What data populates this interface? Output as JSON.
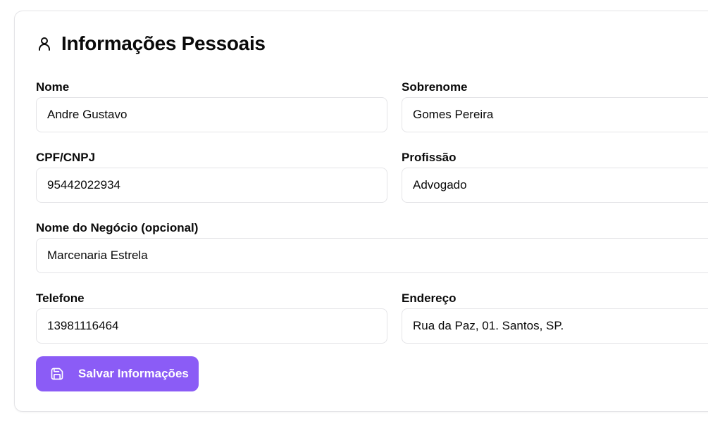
{
  "section": {
    "title": "Informações Pessoais",
    "icon": "user-icon"
  },
  "fields": {
    "nome": {
      "label": "Nome",
      "value": "Andre Gustavo"
    },
    "sobrenome": {
      "label": "Sobrenome",
      "value": "Gomes Pereira"
    },
    "cpf_cnpj": {
      "label": "CPF/CNPJ",
      "value": "95442022934"
    },
    "profissao": {
      "label": "Profissão",
      "value": "Advogado"
    },
    "nome_negocio": {
      "label": "Nome do Negócio (opcional)",
      "value": "Marcenaria Estrela"
    },
    "telefone": {
      "label": "Telefone",
      "value": "13981116464"
    },
    "endereco": {
      "label": "Endereço",
      "value": "Rua da Paz, 01. Santos, SP."
    }
  },
  "actions": {
    "save_label": "Salvar Informações",
    "save_icon": "save-icon"
  },
  "colors": {
    "accent": "#8b5cf6",
    "border": "#e4e4e7",
    "text": "#0a0a0a"
  }
}
